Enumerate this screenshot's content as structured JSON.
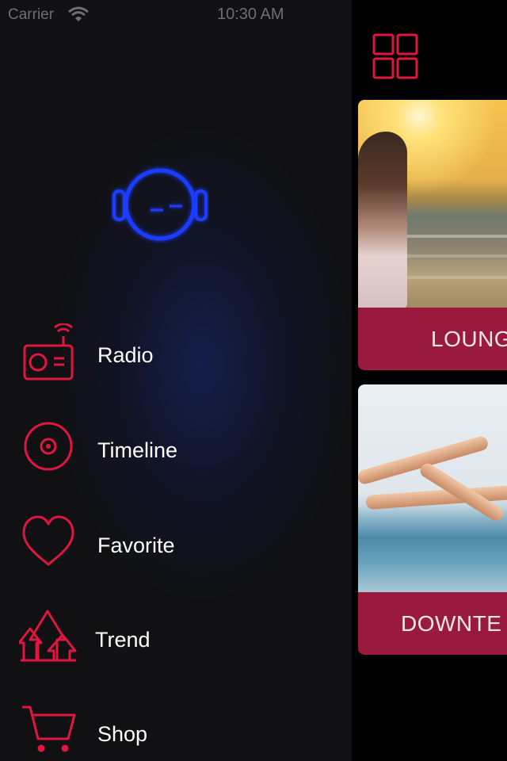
{
  "status_bar": {
    "carrier": "Carrier",
    "time": "10:30 AM"
  },
  "colors": {
    "accent": "#e0163f",
    "avatar_glow": "#1a3cff",
    "card_label_bg": "#9a1a3e"
  },
  "avatar": {
    "icon": "headphones-face-icon"
  },
  "menu": {
    "items": [
      {
        "label": "Radio",
        "icon": "radio-icon"
      },
      {
        "label": "Timeline",
        "icon": "disc-icon"
      },
      {
        "label": "Favorite",
        "icon": "heart-icon"
      },
      {
        "label": "Trend",
        "icon": "trend-arrows-icon"
      },
      {
        "label": "Shop",
        "icon": "cart-icon"
      }
    ]
  },
  "main": {
    "grid_button_icon": "grid-icon",
    "cards": [
      {
        "label": "LOUNG"
      },
      {
        "label": "DOWNTE"
      }
    ]
  }
}
